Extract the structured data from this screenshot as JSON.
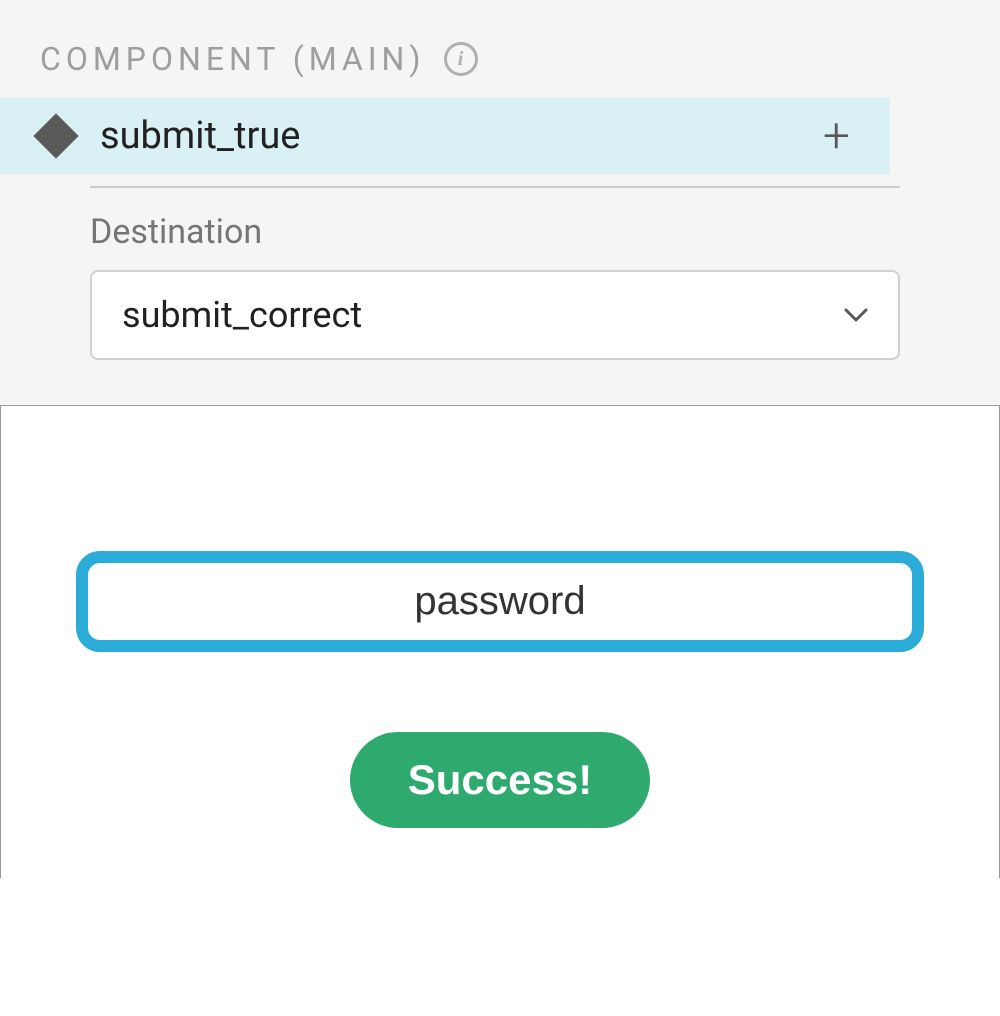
{
  "header": {
    "label": "COMPONENT (MAIN)"
  },
  "variant": {
    "name": "submit_true"
  },
  "destination": {
    "label": "Destination",
    "value": "submit_correct"
  },
  "preview": {
    "input_value": "password",
    "button_label": "Success!"
  },
  "colors": {
    "highlight_bg": "#d9f0f5",
    "input_border": "#2babd8",
    "button_bg": "#2eaa6f"
  }
}
